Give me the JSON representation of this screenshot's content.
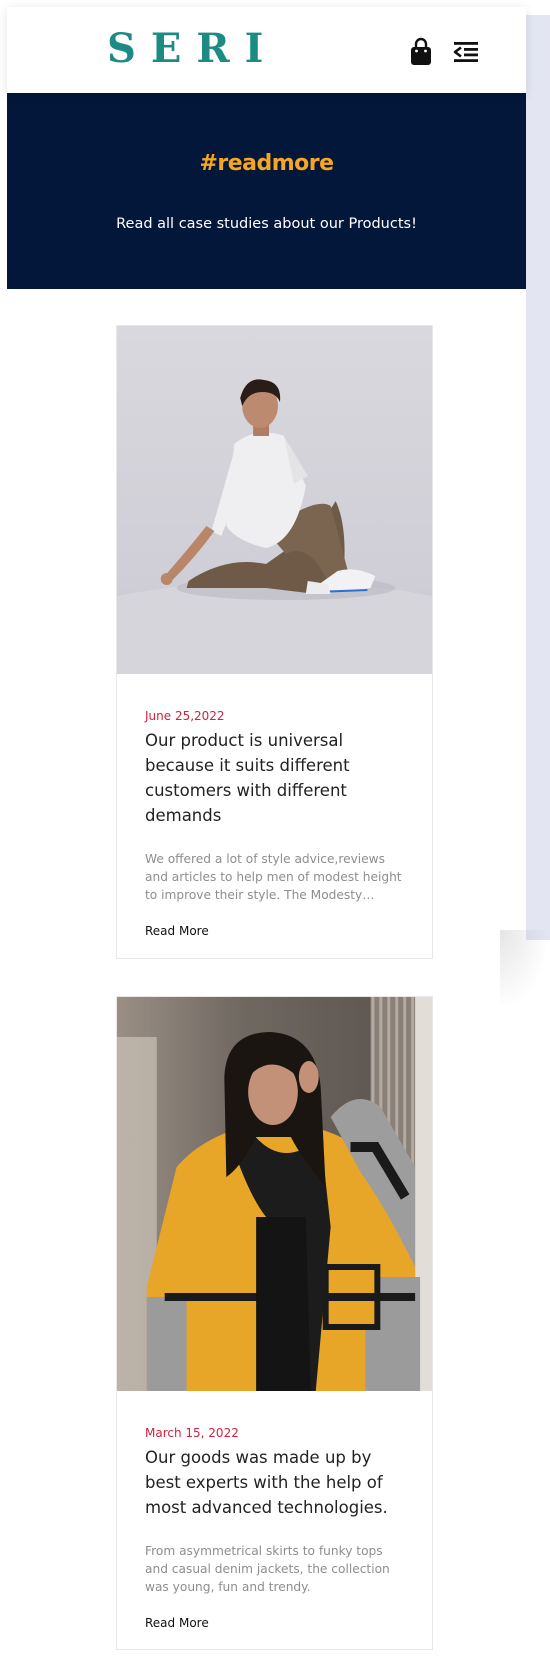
{
  "header": {
    "logo": "SERI",
    "icons": {
      "cart": "shopping-bag-icon",
      "menu": "menu-toggle-icon"
    },
    "brand_color": "#1b8b84"
  },
  "hero": {
    "title": "#readmore",
    "subtitle": "Read all case studies about our Products!",
    "background": "#02173a",
    "title_color": "#f5a623"
  },
  "posts": [
    {
      "image": "man-sitting-photo",
      "date": "June 25,2022",
      "title": "Our product is universal because it suits different customers with different demands",
      "excerpt": "We offered a lot of style advice,reviews and articles to help men of modest height to improve their style. The Modesty…",
      "read_more": "Read More"
    },
    {
      "image": "woman-yellow-coat-photo",
      "date": "March 15, 2022",
      "title": "Our goods was made up by best experts with the help of most advanced technologies.",
      "excerpt": "From asymmetrical skirts to funky tops and casual denim jackets, the collection was young, fun and trendy.",
      "read_more": "Read More"
    }
  ],
  "colors": {
    "date": "#d0223f",
    "side_panel": "#e3e6f2"
  }
}
